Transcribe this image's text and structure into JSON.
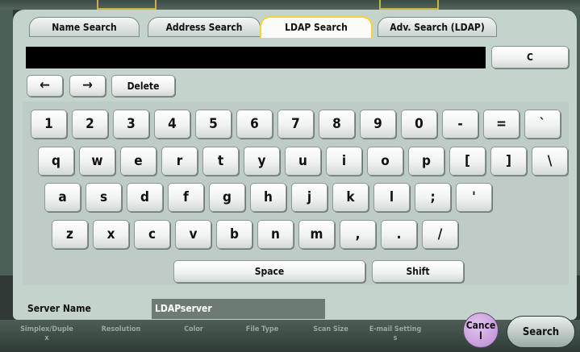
{
  "tabs": [
    {
      "label": "Name Search",
      "active": false
    },
    {
      "label": "Address Search",
      "active": false
    },
    {
      "label": "LDAP Search",
      "active": true
    },
    {
      "label": "Adv. Search (LDAP)",
      "active": false
    }
  ],
  "entry": {
    "value": ""
  },
  "clear_label": "C",
  "edit": {
    "left_arrow": "←",
    "right_arrow": "→",
    "delete_label": "Delete"
  },
  "keyboard": {
    "row1": [
      "1",
      "2",
      "3",
      "4",
      "5",
      "6",
      "7",
      "8",
      "9",
      "0",
      "-",
      "=",
      "`"
    ],
    "row2": [
      "q",
      "w",
      "e",
      "r",
      "t",
      "y",
      "u",
      "i",
      "o",
      "p",
      "[",
      "]",
      "\\"
    ],
    "row3": [
      "a",
      "s",
      "d",
      "f",
      "g",
      "h",
      "j",
      "k",
      "l",
      ";",
      "'"
    ],
    "row4": [
      "z",
      "x",
      "c",
      "v",
      "b",
      "n",
      "m",
      ",",
      ".",
      "/"
    ],
    "space_label": "Space",
    "shift_label": "Shift"
  },
  "server": {
    "label": "Server Name",
    "value": "LDAPserver"
  },
  "actions": {
    "cancel_label": "Cance\nl",
    "search_label": "Search"
  },
  "background_labels": [
    "Simplex/Duple\nx",
    "Resolution",
    "Color",
    "File Type",
    "Scan Size",
    "E-mail Setting\ns"
  ],
  "colors": {
    "active_tab_border": "#f3d23a",
    "panel": "#c4d3cc",
    "cancel": "#c89be0"
  }
}
